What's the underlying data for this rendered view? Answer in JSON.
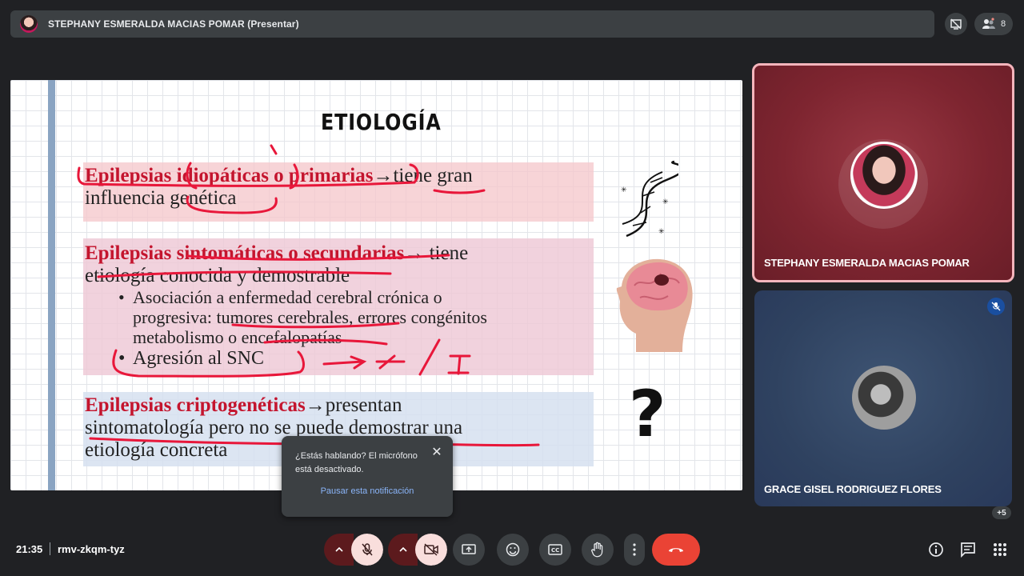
{
  "header": {
    "presenter_title": "STEPHANY ESMERALDA MACIAS POMAR (Presentar)",
    "participant_count": "8"
  },
  "slide": {
    "title": "ETIOLOGÍA",
    "section1": {
      "highlight": "Epilepsias idiopáticas o primarias",
      "line1_rest": "→tiene gran",
      "line2": "influencia genética"
    },
    "section2": {
      "highlight": "Epilepsias sintomáticas o secundarias",
      "line1_rest": "→ tiene",
      "line2": "etiología conocida y demostrable",
      "bullet1_l1": "Asociación a enfermedad cerebral crónica o",
      "bullet1_l2": "progresiva: tumores cerebrales, errores congénitos",
      "bullet1_l3": "metabolismo o encefalopatías",
      "bullet2": "Agresión al SNC"
    },
    "section3": {
      "highlight": "Epilepsias criptogenéticas",
      "line1_rest": "→presentan",
      "line2": "sintomatología pero no se puede demostrar una",
      "line3": "etiología concreta"
    },
    "question_mark": "?"
  },
  "tiles": [
    {
      "name": "STEPHANY ESMERALDA MACIAS POMAR"
    },
    {
      "name": "GRACE GISEL RODRIGUEZ FLORES"
    }
  ],
  "overflow_count": "+5",
  "toast": {
    "message": "¿Estás hablando? El micrófono está desactivado.",
    "action": "Pausar esta notificación"
  },
  "footer": {
    "time": "21:35",
    "meeting_code": "rmv-zkqm-tyz"
  },
  "colors": {
    "background": "#202124",
    "speaking_border": "#f5b5bc",
    "slide_red": "#c4152e",
    "annotation_red": "#e8173a",
    "hangup": "#ea4335",
    "muted_bg": "#f9dedc"
  }
}
